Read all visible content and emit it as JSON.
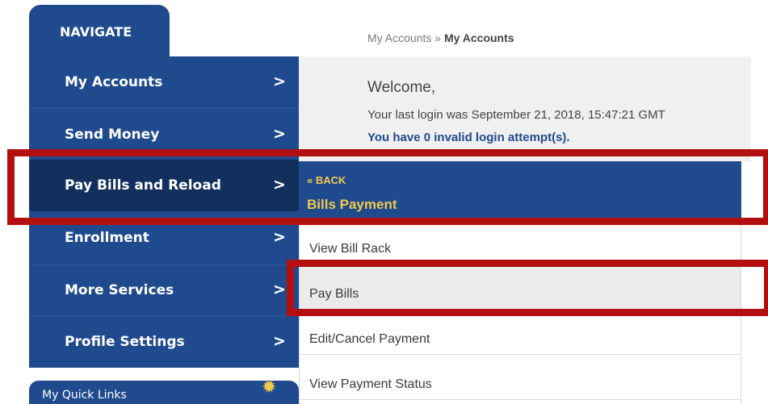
{
  "nav": {
    "tab_label": "NAVIGATE",
    "items": [
      {
        "label": "My Accounts"
      },
      {
        "label": "Send Money"
      },
      {
        "label": "Pay Bills and Reload"
      },
      {
        "label": "Enrollment"
      },
      {
        "label": "More Services"
      },
      {
        "label": "Profile Settings"
      }
    ],
    "chevron": ">",
    "active_index": 2,
    "quick_links_label": "My Quick Links"
  },
  "breadcrumb": {
    "parent": "My Accounts",
    "separator": "»",
    "current": "My Accounts"
  },
  "welcome": {
    "greeting": "Welcome,",
    "last_login": "Your last login was September 21, 2018, 15:47:21 GMT",
    "invalid_attempts": "You have 0 invalid login attempt(s)."
  },
  "submenu": {
    "back_label": "« BACK",
    "title": "Bills Payment",
    "items": [
      {
        "label": "View Bill Rack"
      },
      {
        "label": "Pay Bills"
      },
      {
        "label": "Edit/Cancel Payment"
      },
      {
        "label": "View Payment Status"
      }
    ],
    "highlighted_index": 1
  },
  "colors": {
    "nav_blue": "#1f4a8e",
    "nav_active": "#12305e",
    "accent_gold": "#f2c94c",
    "annotation_red": "#b40f0f"
  }
}
